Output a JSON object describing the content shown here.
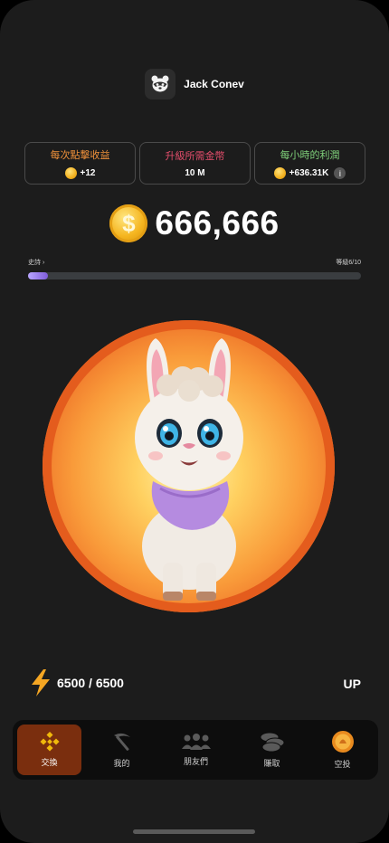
{
  "header": {
    "username": "Jack Conev",
    "avatar_icon": "raccoon-avatar-icon"
  },
  "cards": [
    {
      "title": "每次點擊收益",
      "title_color": "#f0913a",
      "value": "+12",
      "has_coin": true
    },
    {
      "title": "升級所需金幣",
      "title_color": "#e34d6b",
      "value": "10 M",
      "has_coin": false
    },
    {
      "title": "每小時的利潤",
      "title_color": "#7fd07a",
      "value": "+636.31K",
      "has_coin": true,
      "has_info": true
    }
  ],
  "balance": {
    "value": "666,666",
    "coin_symbol": "$"
  },
  "progress": {
    "rank_label": "史詩 ›",
    "level_label": "等級6/10",
    "fill_fraction": 0.06
  },
  "energy": {
    "value": "6500 / 6500",
    "icon": "lightning-icon"
  },
  "up_label": "UP",
  "nav": [
    {
      "label": "交換",
      "icon": "binance-icon",
      "active": true
    },
    {
      "label": "我的",
      "icon": "pickaxe-icon",
      "active": false
    },
    {
      "label": "朋友們",
      "icon": "friends-icon",
      "active": false
    },
    {
      "label": "賺取",
      "icon": "coins-icon",
      "active": false
    },
    {
      "label": "空投",
      "icon": "airdrop-coin-icon",
      "active": false
    }
  ],
  "colors": {
    "accent": "#f0913a",
    "nav_active": "#7a2e0e",
    "background": "#1c1c1c"
  }
}
